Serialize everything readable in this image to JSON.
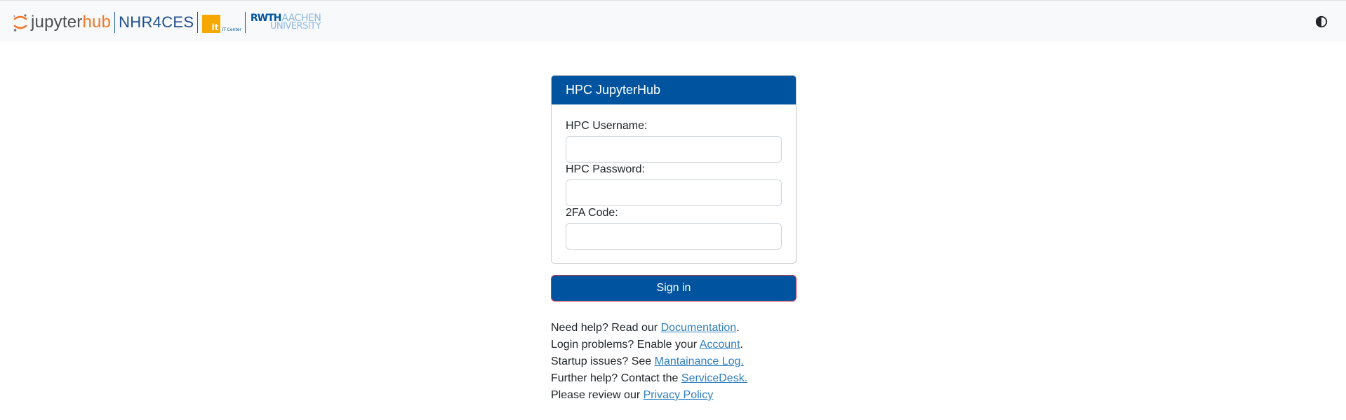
{
  "header": {
    "logo_jupyter": "jupyter",
    "logo_hub": "hub",
    "logo_nhr": "NHR4CES",
    "logo_itc_mark": "it",
    "logo_itc_label": "IT Center",
    "logo_rwth": "RWTH",
    "logo_aachen": "AACHEN",
    "logo_university": "UNIVERSITY",
    "theme_toggle_icon": "half-circle-contrast-icon"
  },
  "login": {
    "title": "HPC JupyterHub",
    "username_label": "HPC Username:",
    "username_value": "",
    "password_label": "HPC Password:",
    "password_value": "",
    "twofa_label": "2FA Code:",
    "twofa_value": "",
    "submit_label": "Sign in"
  },
  "help": {
    "line1_prefix": "Need help? Read our ",
    "line1_link": "Documentation",
    "line1_suffix": ".",
    "line2_prefix": "Login problems? Enable your ",
    "line2_link": "Account",
    "line2_suffix": ".",
    "line3_prefix": "Startup issues? See ",
    "line3_link": "Mantainance Log.",
    "line4_prefix": "Further help? Contact the ",
    "line4_link": "ServiceDesk.",
    "line5_prefix": "Please review our ",
    "line5_link": "Privacy Policy"
  },
  "colors": {
    "primary": "#00549f",
    "accent_orange": "#f37726",
    "itc_yellow": "#f6a800",
    "link": "#2f7fc0",
    "button_border": "#dc3545"
  }
}
